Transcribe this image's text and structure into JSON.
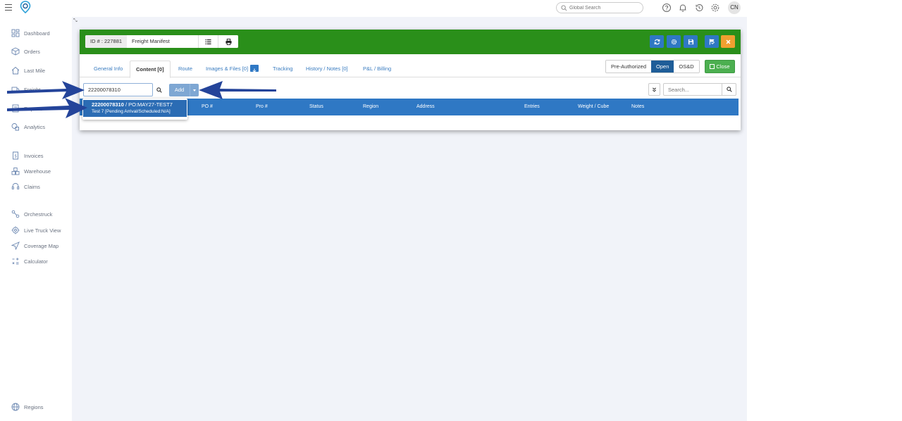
{
  "topbar": {
    "global_search_placeholder": "Global Search",
    "avatar_initials": "CN",
    "icons": [
      "menu-icon",
      "help-icon",
      "bell-icon",
      "history-icon",
      "gear-icon"
    ]
  },
  "sidebar": {
    "items": [
      {
        "label": "Dashboard",
        "icon": "dashboard-icon"
      },
      {
        "label": "Orders",
        "icon": "box-icon"
      },
      {
        "label": "Last Mile",
        "icon": "house-icon"
      },
      {
        "label": "Freight",
        "icon": "truck-icon"
      },
      {
        "label": "Reports",
        "icon": "report-icon"
      },
      {
        "label": "Analytics",
        "icon": "analytics-icon"
      },
      {
        "label": "Invoices",
        "icon": "invoice-icon"
      },
      {
        "label": "Warehouse",
        "icon": "warehouse-icon"
      },
      {
        "label": "Claims",
        "icon": "headset-icon"
      },
      {
        "label": "Orchestruck",
        "icon": "route-icon"
      },
      {
        "label": "Live Truck View",
        "icon": "target-icon"
      },
      {
        "label": "Coverage Map",
        "icon": "send-icon"
      },
      {
        "label": "Calculator",
        "icon": "calculator-icon"
      },
      {
        "label": "Regions",
        "icon": "globe-icon"
      }
    ]
  },
  "manifest": {
    "id_label": "ID # : 227881",
    "title": "Freight Manifest",
    "colors": {
      "header": "#2a8f1a",
      "primary": "#2f78c4",
      "warning": "#f0a030",
      "success": "#4caf50"
    }
  },
  "tabs": [
    {
      "label": "General Info",
      "active": false
    },
    {
      "label": "Content [0]",
      "active": true
    },
    {
      "label": "Route",
      "active": false
    },
    {
      "label": "Images & Files [0]",
      "active": false
    },
    {
      "label": "Tracking",
      "active": false
    },
    {
      "label": "History / Notes [0]",
      "active": false
    },
    {
      "label": "P&L / Billing",
      "active": false
    }
  ],
  "status": {
    "options": [
      "Pre-Authorized",
      "Open",
      "OS&D"
    ],
    "selected": "Open",
    "close_label": "Close"
  },
  "content": {
    "search_value": "22200078310",
    "add_label": "Add",
    "right_search_placeholder": "Search...",
    "columns": [
      "PO #",
      "Pro #",
      "Status",
      "Region",
      "Address",
      "Entries",
      "Weight / Cube",
      "Notes"
    ]
  },
  "autocomplete": {
    "line1_bold": "22200078310",
    "line1_rest": " / PO:MAY27-TEST7",
    "line2": "Test 7 [Pending Arrival/Scheduled:N/A]"
  }
}
